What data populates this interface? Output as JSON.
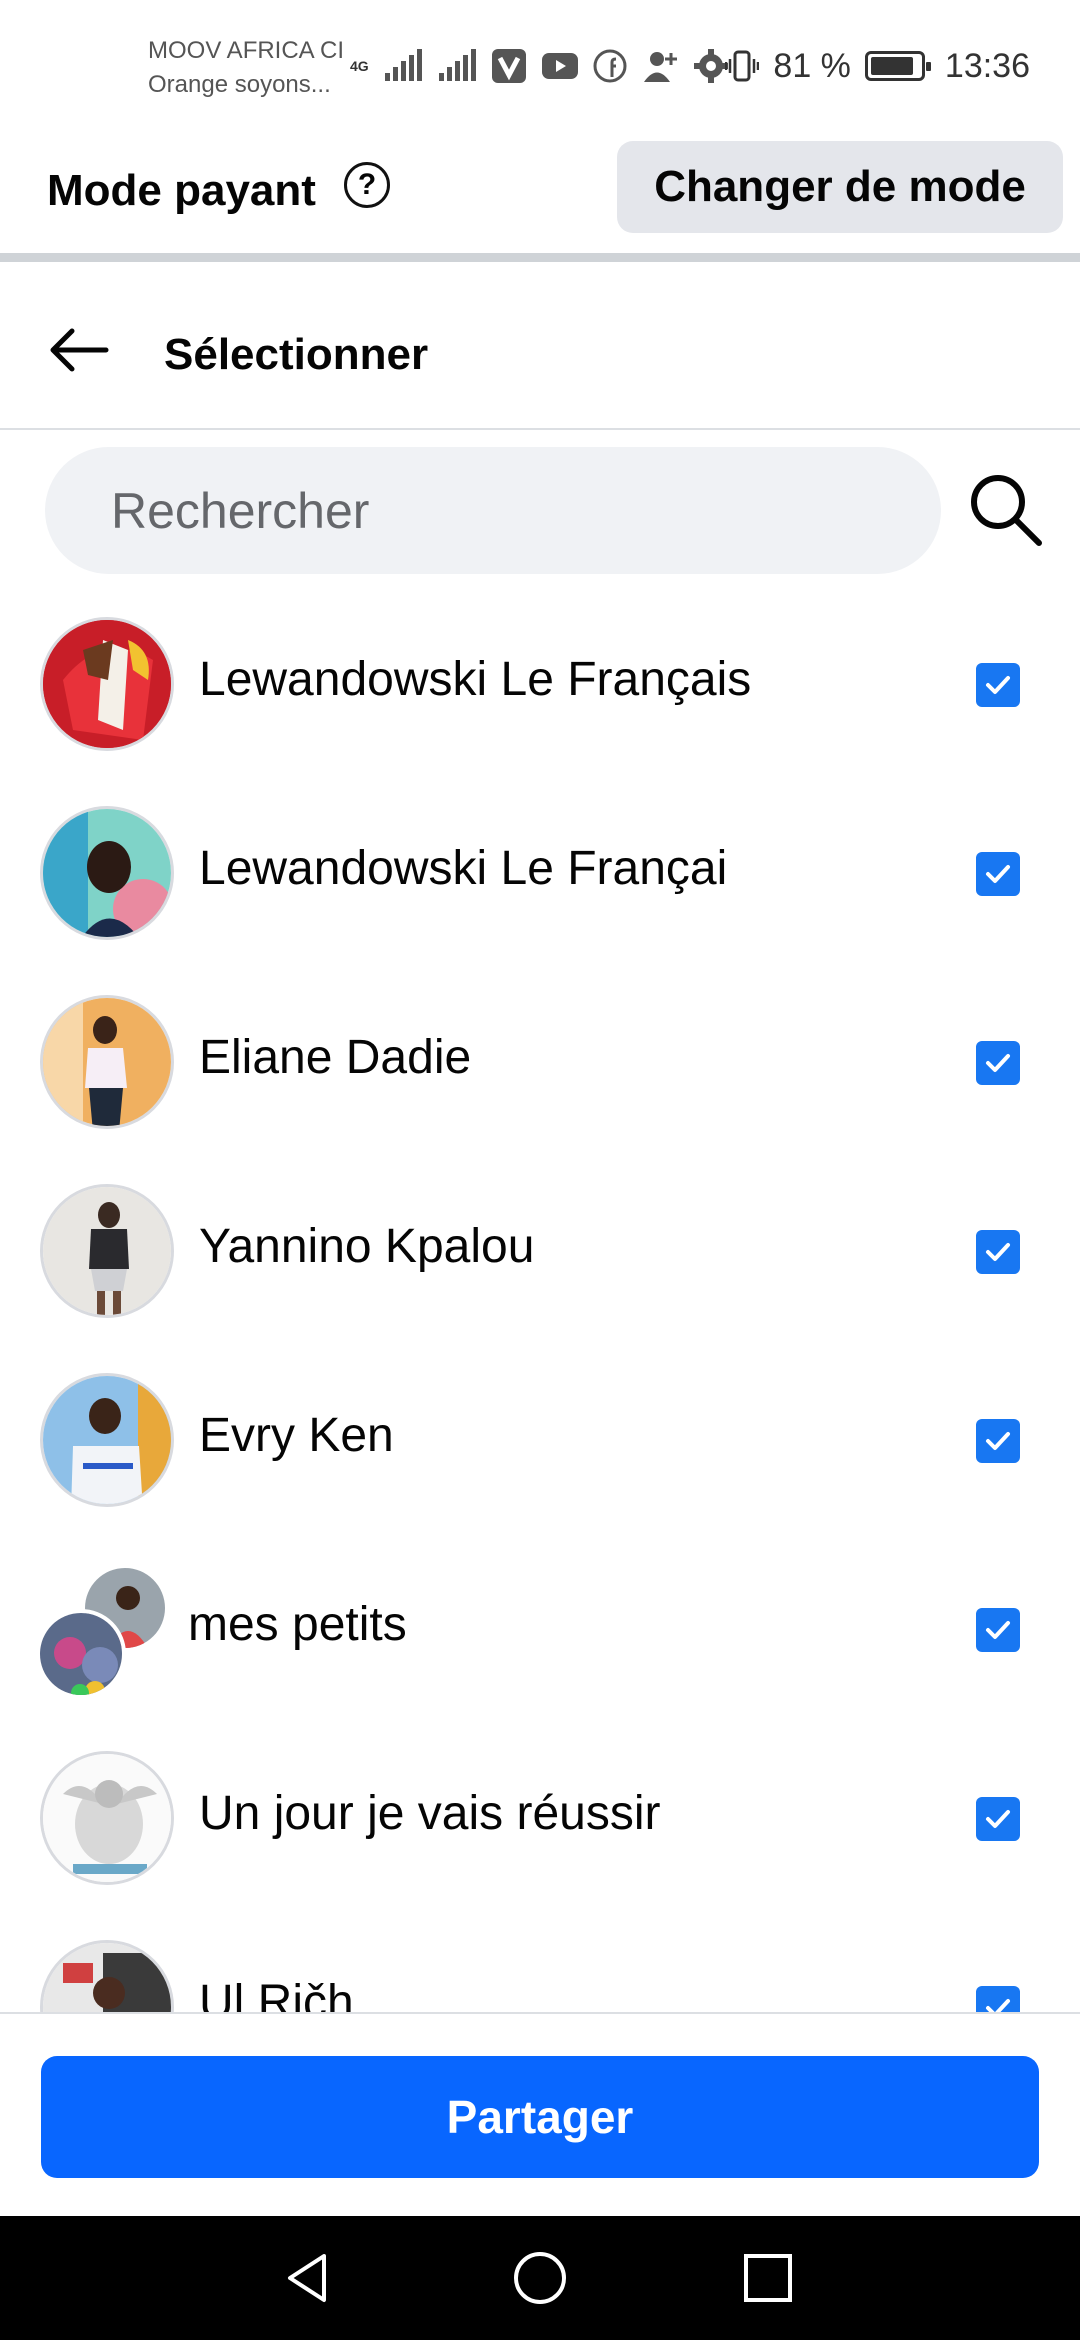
{
  "status_bar": {
    "carrier_line1": "MOOV AFRICA CI",
    "carrier_line2": "Orange soyons...",
    "network_type": "4G",
    "battery_percent": "81 %",
    "time": "13:36",
    "icons": [
      "signal-icon",
      "signal-icon",
      "viber-icon",
      "youtube-icon",
      "facebook-icon",
      "add-person-icon",
      "settings-icon",
      "vibrate-icon",
      "battery-icon"
    ]
  },
  "mode_bar": {
    "title": "Mode payant",
    "help_symbol": "?",
    "change_button": "Changer de mode"
  },
  "header": {
    "title": "Sélectionner"
  },
  "search": {
    "placeholder": "Rechercher"
  },
  "contacts": [
    {
      "name": "Lewandowski Le Français",
      "checked": true
    },
    {
      "name": "Lewandowski Le Françai",
      "checked": true
    },
    {
      "name": "Eliane Dadie",
      "checked": true
    },
    {
      "name": "Yannino Kpalou",
      "checked": true
    },
    {
      "name": "Evry Ken",
      "checked": true
    },
    {
      "name": "mes petits",
      "checked": true,
      "group": true
    },
    {
      "name": " Un jour je vais réussir",
      "checked": true
    },
    {
      "name": "Ul Ričh",
      "checked": true
    }
  ],
  "footer": {
    "share_button": "Partager"
  },
  "colors": {
    "accent": "#1877f2",
    "share_button": "#0866ff",
    "search_bg": "#f0f2f5",
    "mode_button_bg": "#e4e6eb"
  }
}
